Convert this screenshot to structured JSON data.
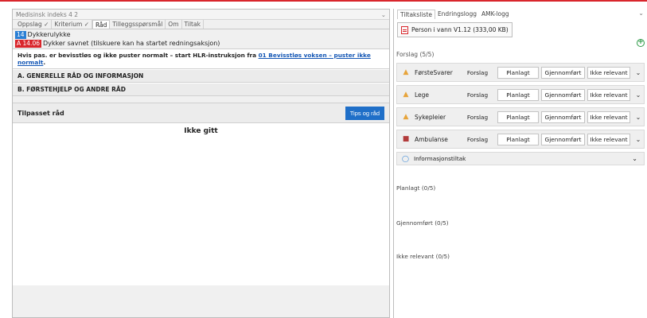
{
  "left": {
    "title": "Medisinsk indeks 4 2",
    "tabs": [
      "Oppslag ✓",
      "Kriterium ✓",
      "Råd",
      "Tilleggsspørsmål",
      "Om",
      "Tiltak"
    ],
    "code_index": {
      "num": "14",
      "label": "Dykkerulykke"
    },
    "code_criterion": {
      "num": "A 14.06",
      "label": "Dykker savnet (tilskuere kan ha startet redningsaksjon)"
    },
    "warning": {
      "text": "Hvis pas. er bevisstløs og ikke puster normalt – start HLR-instruksjon fra",
      "link": "01 Bevisstløs voksen – puster ikke normalt",
      "tail": "."
    },
    "sections": [
      "A. GENERELLE RÅD OG INFORMASJON",
      "B. FØRSTEHJELP OG ANDRE RÅD"
    ],
    "advice": {
      "title": "Tilpasset råd",
      "tips_button": "Tips og råd",
      "empty_text": "Ikke gitt"
    }
  },
  "right": {
    "tabs": [
      "Tiltaksliste",
      "Endringslogg",
      "AMK-logg"
    ],
    "file_button": "Person i vann V1.12 (333,00 KB)",
    "forslag_label": "Forslag (5/5)",
    "buttons": {
      "forslag": "Forslag",
      "planlagt": "Planlagt",
      "gjennomfort": "Gjennomført",
      "ikke_relevant": "Ikke relevant"
    },
    "roles": [
      {
        "name": "FørsteSvarer",
        "icon": "person-icon"
      },
      {
        "name": "Lege",
        "icon": "person-icon"
      },
      {
        "name": "Sykepleier",
        "icon": "person-icon"
      },
      {
        "name": "Ambulanse",
        "icon": "ambulance-icon"
      }
    ],
    "info_label": "Informasjonstiltak",
    "statuses": [
      "Planlagt (0/5)",
      "Gjennomført (0/5)",
      "Ikke relevant (0/5)"
    ]
  },
  "colors": {
    "accent_blue": "#1f6fc8",
    "alert_red": "#d9262c",
    "add_green": "#2e9a47"
  }
}
